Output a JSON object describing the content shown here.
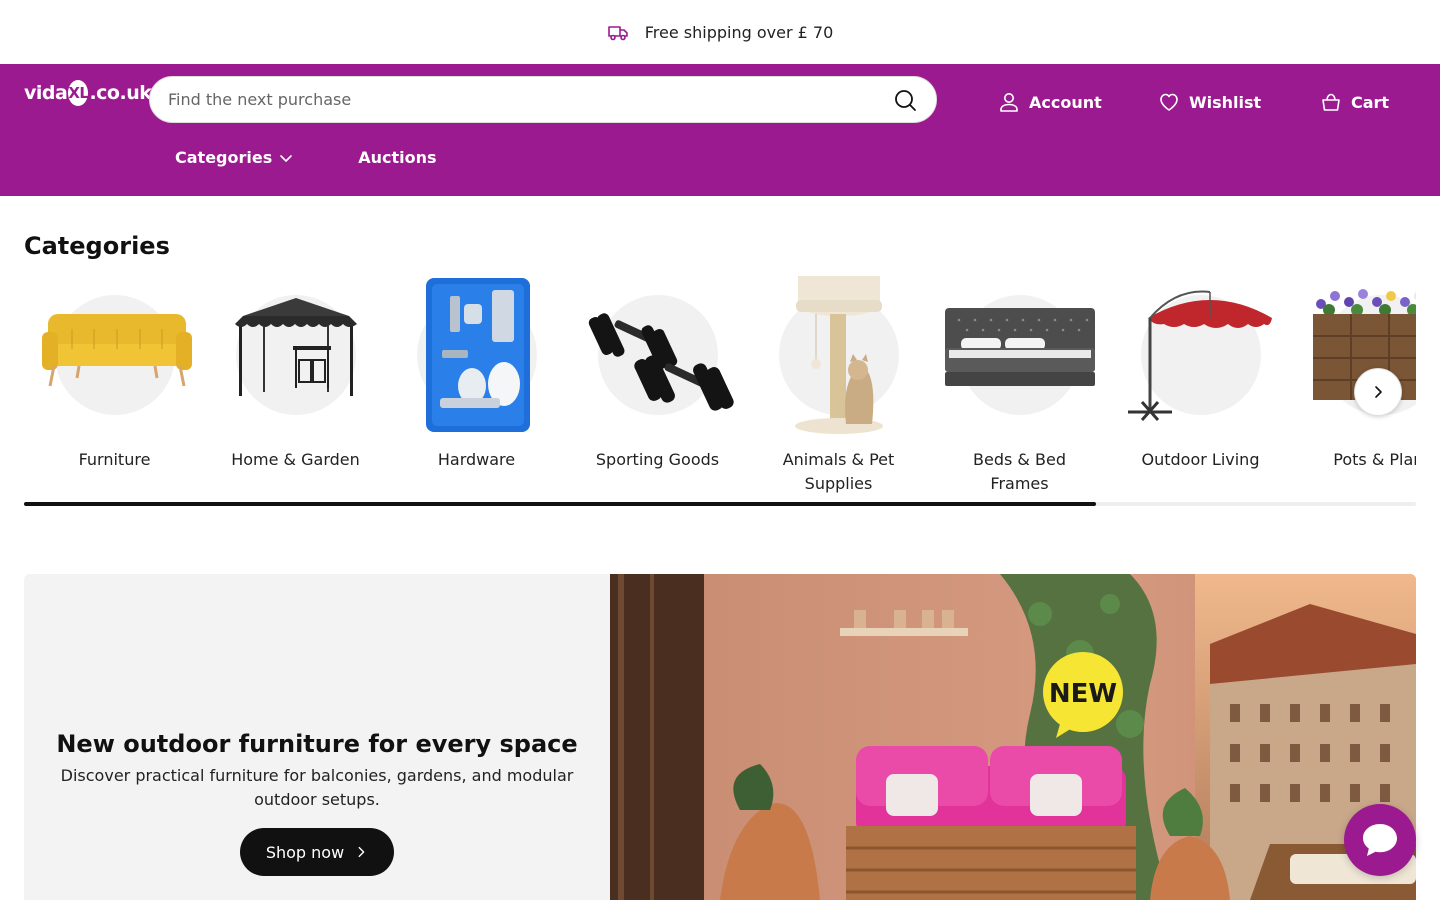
{
  "promo": {
    "text": "Free shipping over £ 70"
  },
  "header": {
    "logo_text_1": "vida",
    "logo_text_2": "XL",
    "logo_text_3": ".co.uk",
    "search_placeholder": "Find the next purchase",
    "account_label": "Account",
    "wishlist_label": "Wishlist",
    "cart_label": "Cart",
    "nav": {
      "categories_label": "Categories",
      "auctions_label": "Auctions"
    },
    "brand_color": "#9c1a8f"
  },
  "categories": {
    "title": "Categories",
    "items": [
      {
        "label": "Furniture",
        "icon": "sofa-image"
      },
      {
        "label": "Home & Garden",
        "icon": "gazebo-image"
      },
      {
        "label": "Hardware",
        "icon": "spray-gun-kit-image"
      },
      {
        "label": "Sporting Goods",
        "icon": "dumbbells-image"
      },
      {
        "label": "Animals & Pet Supplies",
        "icon": "cat-tree-image"
      },
      {
        "label": "Beds & Bed Frames",
        "icon": "bed-image"
      },
      {
        "label": "Outdoor Living",
        "icon": "parasol-image"
      },
      {
        "label": "Pots & Plant",
        "icon": "planter-image"
      }
    ],
    "scroll_progress": 0.77
  },
  "hero": {
    "title": "New outdoor furniture for every space",
    "subtitle": "Discover practical furniture for balconies, gardens, and modular outdoor setups.",
    "button_label": "Shop now",
    "badge": "NEW"
  }
}
